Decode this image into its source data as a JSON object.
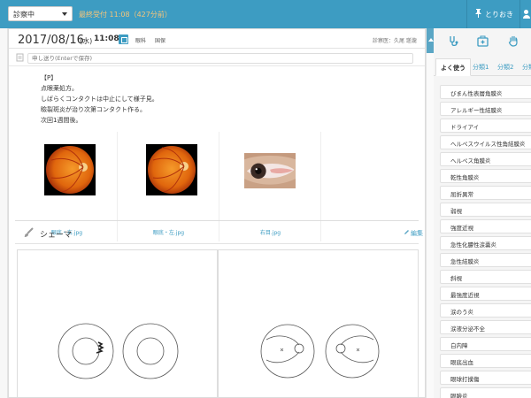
{
  "topbar": {
    "status_value": "診察中",
    "last_reception": "最終受付 11:08（427分前）",
    "pin_label": "とりおき"
  },
  "visit": {
    "date": "2017/08/16",
    "dow": "(水)",
    "time": "11:08",
    "department": "眼科",
    "insurance": "国保",
    "doctor": "診察医：久尾 瑳瀧"
  },
  "memo": {
    "placeholder": "申し送り(Enterで保存)"
  },
  "note_lines": [
    "【P】",
    "点眼薬処方。",
    "しばらくコンタクトは中止にして様子見。",
    "瞼裂斑炎が治り次第コンタクト作る。",
    "次回1週間後。"
  ],
  "images": [
    {
      "name": "眼底・右.jpg",
      "kind": "fundus"
    },
    {
      "name": "眼底・左.jpg",
      "kind": "fundus"
    },
    {
      "name": "右目.jpg",
      "kind": "eye"
    }
  ],
  "schema": {
    "title": "シェーマ",
    "edit_label": "編集"
  },
  "right_panel": {
    "tabs": [
      "よく使う",
      "分類1",
      "分類2",
      "分類"
    ],
    "items": [
      "びまん性表層角膜炎",
      "アレルギー性結膜炎",
      "ドライアイ",
      "ヘルペスウイルス性角結膜炎",
      "ヘルペス角膜炎",
      "乾性角膜炎",
      "屈折異常",
      "弱視",
      "強度近視",
      "急性化膿性涙嚢炎",
      "急性結膜炎",
      "斜視",
      "最強度近視",
      "涙のう炎",
      "涙液分泌不全",
      "白内障",
      "眼底出血",
      "眼球打撲傷",
      "眼瞼炎"
    ]
  },
  "colors": {
    "accent": "#3d9cc2",
    "topbar": "#3d9cc2",
    "warning_text": "#f5c57a"
  }
}
